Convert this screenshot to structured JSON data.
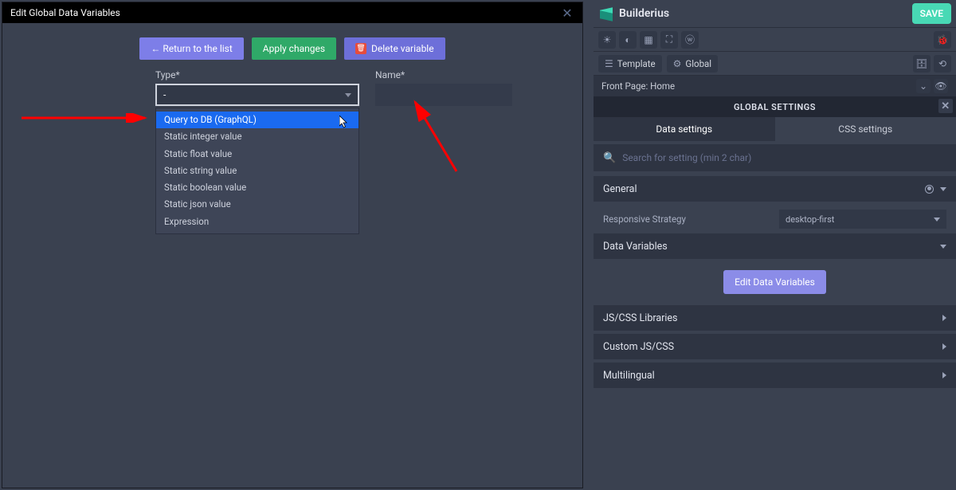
{
  "modal": {
    "title": "Edit Global Data Variables",
    "toolbar": {
      "return": "←  Return to the list",
      "apply": "Apply changes",
      "delete": "Delete variable"
    },
    "form": {
      "type_label": "Type*",
      "type_value": "-",
      "name_label": "Name*",
      "name_value": "",
      "options": [
        "Query to DB (GraphQL)",
        "Static integer value",
        "Static float value",
        "Static string value",
        "Static boolean value",
        "Static json value",
        "Expression"
      ]
    }
  },
  "brand": {
    "name": "Builderius"
  },
  "save": "SAVE",
  "crumb": {
    "template": "Template",
    "global": "Global"
  },
  "pagebar": {
    "text": "Front Page: Home"
  },
  "settings": {
    "title": "GLOBAL SETTINGS",
    "tabs": {
      "data": "Data settings",
      "css": "CSS settings"
    },
    "search_placeholder": "Search for setting (min 2 char)",
    "sections": {
      "general": "General",
      "responsive": "Responsive Strategy",
      "responsive_value": "desktop-first",
      "data_vars": "Data Variables",
      "edit_btn": "Edit Data Variables",
      "jscss": "JS/CSS Libraries",
      "custom": "Custom JS/CSS",
      "multi": "Multilingual"
    }
  }
}
